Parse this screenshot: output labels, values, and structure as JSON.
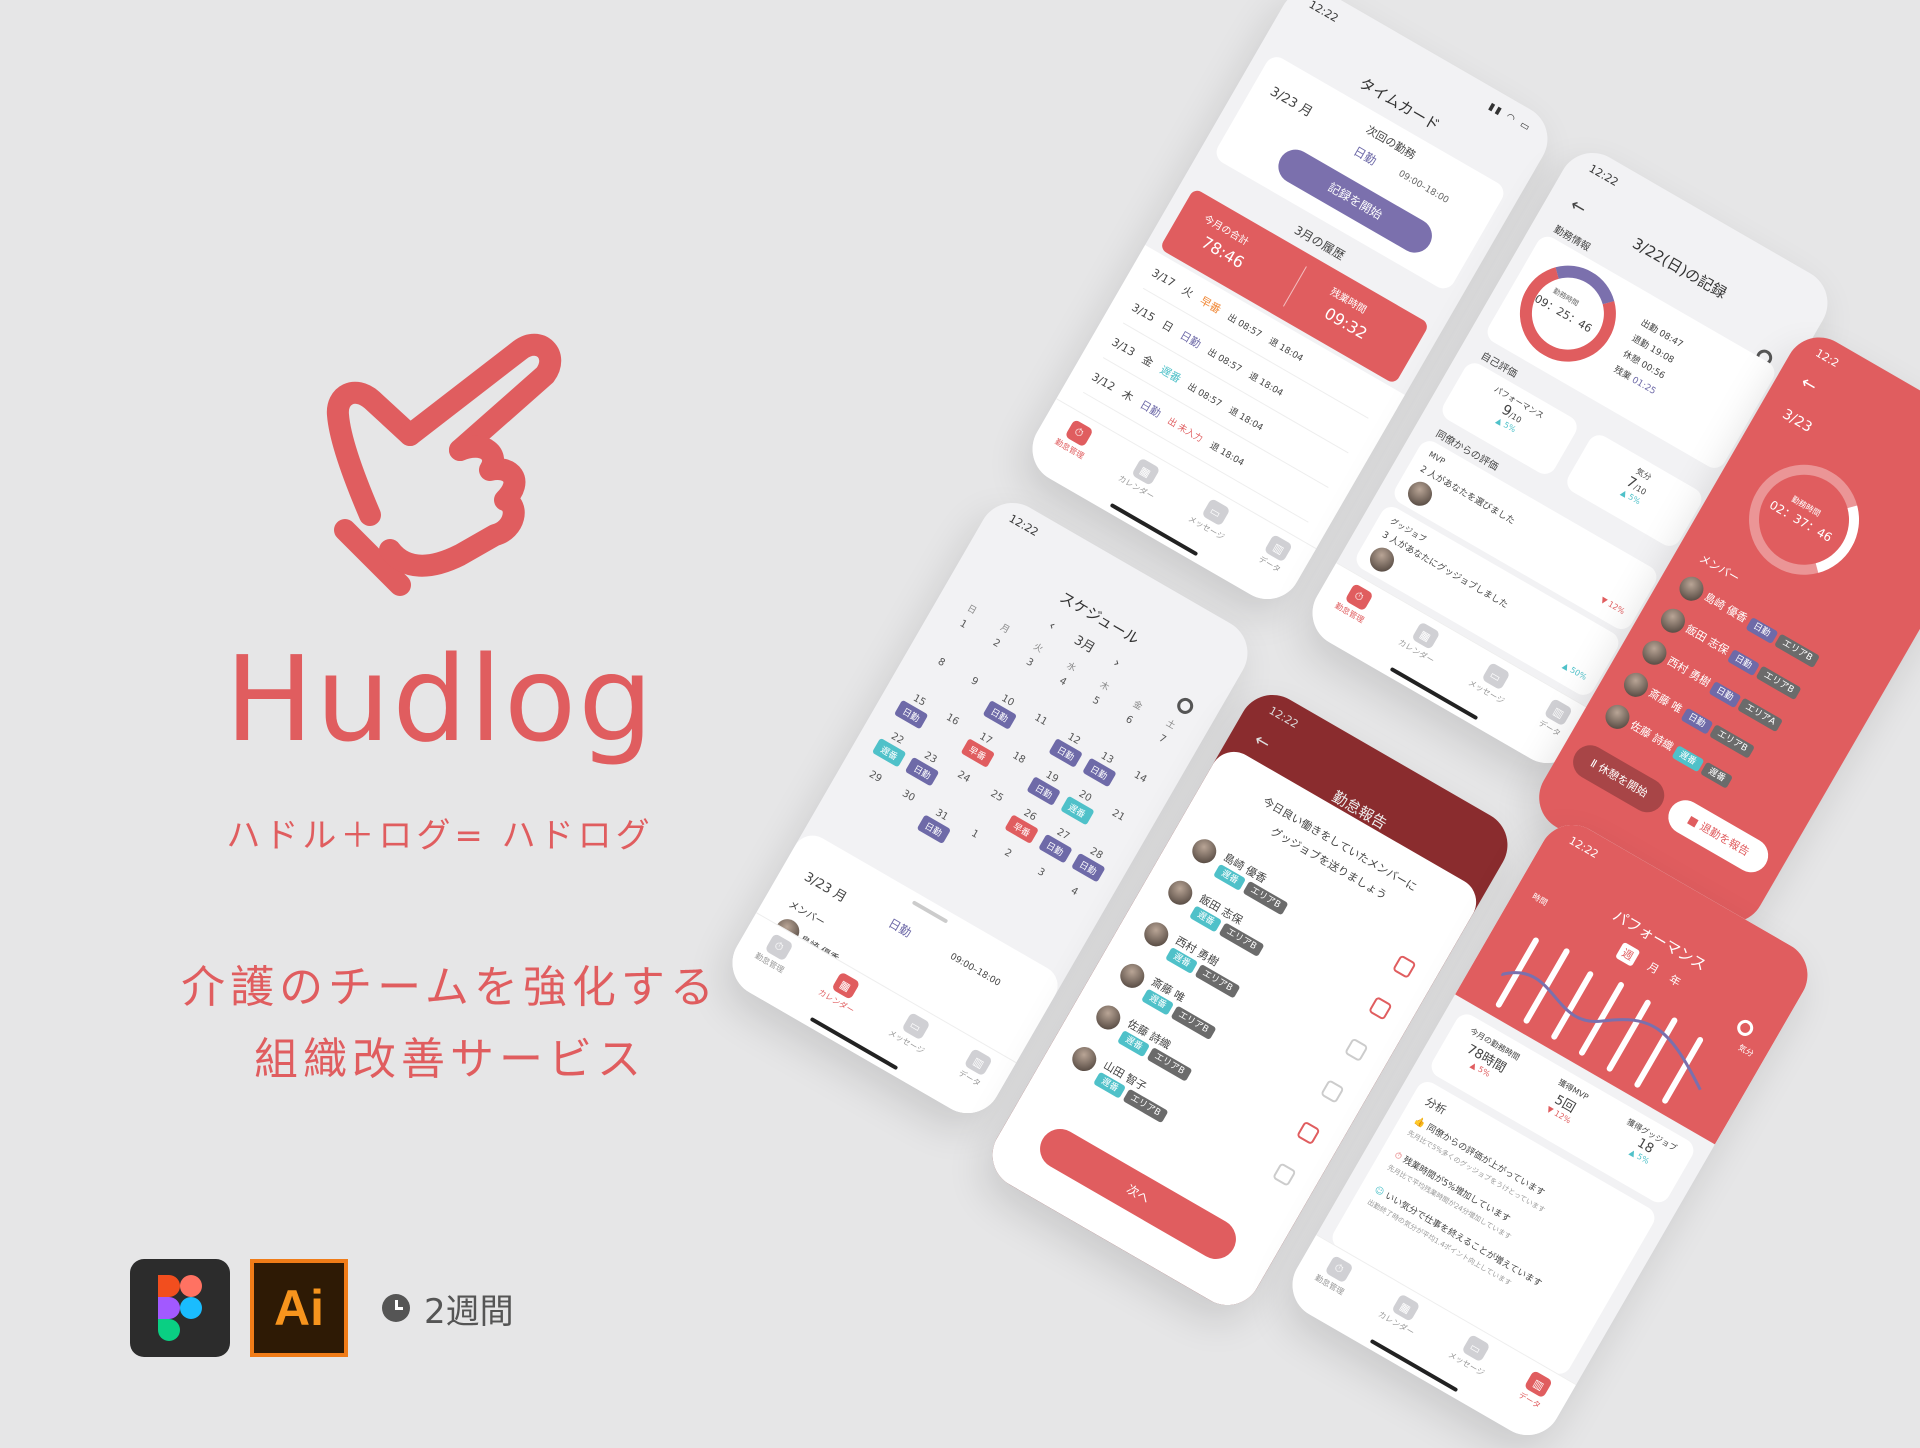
{
  "brand": {
    "name": "Hudlog",
    "tagline": "ハドル＋ログ= ハドログ",
    "headline_line1": "介護のチームを強化する",
    "headline_line2": "組織改善サービス",
    "primary_color": "#e05d5f",
    "icon": "pointing-hand-icon"
  },
  "tools": {
    "figma_icon": "figma-icon",
    "illustrator_label": "Ai",
    "duration": "2週間"
  },
  "timecard": {
    "status_time": "12:22",
    "title": "タイムカード",
    "next_label": "次回の勤務",
    "next_date": "3/23",
    "next_weekday": "月",
    "next_shift": "日勤",
    "next_hours": "09:00–18:00",
    "start_button": "記録を開始",
    "history_title": "3月の履歴",
    "total_label": "今月の合計",
    "total_value": "78:46",
    "overtime_label": "残業時間",
    "overtime_value": "09:32",
    "rows": [
      {
        "date": "3/17",
        "wd": "火",
        "shift": "早番",
        "in": "出 08:57",
        "out": "退 18:04"
      },
      {
        "date": "3/15",
        "wd": "日",
        "shift": "日勤",
        "in": "出 08:57",
        "out": "退 18:04"
      },
      {
        "date": "3/13",
        "wd": "金",
        "shift": "遅番",
        "in": "出 08:57",
        "out": "退 18:04"
      },
      {
        "date": "3/12",
        "wd": "木",
        "shift": "日勤",
        "in": "出 未入力",
        "out": "退 18:04"
      }
    ]
  },
  "record": {
    "status_time": "12:22",
    "title": "3/22(日)の記録",
    "section_work": "勤務情報",
    "ring_label": "勤務時間",
    "ring_value": "09：25：46",
    "in_label": "出勤",
    "in_value": "08:47",
    "out_label": "退勤",
    "out_value": "19:08",
    "break_label": "休憩",
    "break_value": "00:56",
    "ot_label": "残業",
    "ot_value": "01:25",
    "self_eval": "自己評価",
    "perf_label": "パフォーマンス",
    "perf_value": "9",
    "perf_unit": "/10",
    "perf_delta": "5%",
    "mood_label": "気分",
    "mood_value": "7",
    "mood_unit": "/10",
    "mood_delta": "5%",
    "peer_eval": "同僚からの評価",
    "mvp_label": "MVP",
    "mvp_text": "2 人があなたを選びました",
    "mvp_delta": "12%",
    "gj_label": "グッジョブ",
    "gj_text": "3 人があなたにグッジョブしました",
    "gj_delta": "50%"
  },
  "active": {
    "status_time": "12:2",
    "date": "3/23",
    "ring_label": "勤務時間",
    "ring_value": "02：37：46",
    "members_label": "メンバー",
    "members": [
      {
        "name": "島崎 優香",
        "shift": "日勤",
        "area": "エリアB"
      },
      {
        "name": "飯田 志保",
        "shift": "日勤",
        "area": "エリアB"
      },
      {
        "name": "西村 勇樹",
        "shift": "日勤",
        "area": "エリアA"
      },
      {
        "name": "斎藤 唯",
        "shift": "日勤",
        "area": "エリアB"
      },
      {
        "name": "佐藤 詩織",
        "shift": "遅番",
        "area": "遅番"
      }
    ],
    "break_button": "休憩を開始",
    "leave_button": "退勤を報告"
  },
  "schedule": {
    "status_time": "12:22",
    "title": "スケジュール",
    "month": "3月",
    "weekdays": [
      "日",
      "月",
      "火",
      "水",
      "木",
      "金",
      "土"
    ],
    "days": [
      {
        "d": "1",
        "s": ""
      },
      {
        "d": "2",
        "s": ""
      },
      {
        "d": "3",
        "s": ""
      },
      {
        "d": "4",
        "s": ""
      },
      {
        "d": "5",
        "s": ""
      },
      {
        "d": "6",
        "s": ""
      },
      {
        "d": "7",
        "s": ""
      },
      {
        "d": "8",
        "s": ""
      },
      {
        "d": "9",
        "s": ""
      },
      {
        "d": "10",
        "s": "日勤"
      },
      {
        "d": "11",
        "s": ""
      },
      {
        "d": "12",
        "s": "日勤"
      },
      {
        "d": "13",
        "s": "日勤"
      },
      {
        "d": "14",
        "s": ""
      },
      {
        "d": "15",
        "s": "日勤"
      },
      {
        "d": "16",
        "s": ""
      },
      {
        "d": "17",
        "s": "早番"
      },
      {
        "d": "18",
        "s": ""
      },
      {
        "d": "19",
        "s": "日勤"
      },
      {
        "d": "20",
        "s": "遅番"
      },
      {
        "d": "21",
        "s": ""
      },
      {
        "d": "22",
        "s": "遅番"
      },
      {
        "d": "23",
        "s": "日勤"
      },
      {
        "d": "24",
        "s": ""
      },
      {
        "d": "25",
        "s": ""
      },
      {
        "d": "26",
        "s": "早番"
      },
      {
        "d": "27",
        "s": "日勤"
      },
      {
        "d": "28",
        "s": "日勤"
      },
      {
        "d": "29",
        "s": ""
      },
      {
        "d": "30",
        "s": ""
      },
      {
        "d": "31",
        "s": "日勤"
      },
      {
        "d": "1",
        "s": ""
      },
      {
        "d": "2",
        "s": ""
      },
      {
        "d": "3",
        "s": ""
      },
      {
        "d": "4",
        "s": ""
      }
    ],
    "sheet_date": "3/23",
    "sheet_wd": "月",
    "sheet_shift": "日勤",
    "sheet_hours": "09:00–18:00",
    "sheet_members": "メンバー",
    "sheet_member": "島崎 優香"
  },
  "report": {
    "status_time": "12:22",
    "title": "勤怠報告",
    "prompt_line1": "今日良い働きをしていたメンバーに",
    "prompt_line2": "グッジョブを送りましょう",
    "members": [
      {
        "name": "島崎 優香",
        "shift": "遅番",
        "area": "エリアB",
        "liked": true
      },
      {
        "name": "飯田 志保",
        "shift": "遅番",
        "area": "エリアB",
        "liked": true
      },
      {
        "name": "西村 勇樹",
        "shift": "遅番",
        "area": "エリアB",
        "liked": false
      },
      {
        "name": "斎藤 唯",
        "shift": "遅番",
        "area": "エリアB",
        "liked": false
      },
      {
        "name": "佐藤 詩織",
        "shift": "遅番",
        "area": "エリアB",
        "liked": true
      },
      {
        "name": "山田 智子",
        "shift": "遅番",
        "area": "エリアB",
        "liked": false
      }
    ],
    "next_button": "次へ"
  },
  "performance": {
    "status_time": "12:22",
    "title": "パフォーマンス",
    "periods": [
      "週",
      "月",
      "年"
    ],
    "left_axis_label": "時間",
    "right_axis_label": "気分",
    "hours_label": "今月の勤務時間",
    "hours_value": "78時間",
    "hours_delta": "5%",
    "mvp_label": "獲得MVP",
    "mvp_value": "5回",
    "mvp_delta": "12%",
    "gj_label": "獲得グッジョブ",
    "gj_value": "18",
    "gj_delta": "5%",
    "analysis_title": "分析",
    "analysis": [
      {
        "text": "同僚からの評価が上がっています",
        "sub": "先月比で5%多くのグッジョブをうけとっています"
      },
      {
        "text": "残業時間が5%増加しています",
        "sub": "先月比で平均残業時間が24分増加しています"
      },
      {
        "text": "いい気分で仕事を終えることが増えています",
        "sub": "出勤終了時の気分が平均1.4ポイント向上しています"
      }
    ]
  },
  "tabs": [
    "勤怠管理",
    "カレンダー",
    "メッセージ",
    "データ"
  ]
}
